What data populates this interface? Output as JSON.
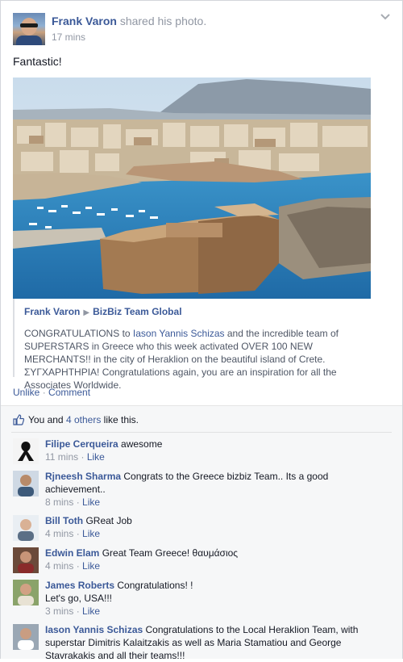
{
  "post": {
    "author": "Frank Varon",
    "action": "shared his photo.",
    "time": "17 mins",
    "status": "Fantastic!"
  },
  "attachment": {
    "source_author": "Frank Varon",
    "source_page": "BizBiz Team Global",
    "body_pre": "CONGRATULATIONS to ",
    "body_link": "Iason Yannis Schizas",
    "body_post": " and the incredible team of SUPERSTARS in Greece who this week activated OVER 100 NEW MERCHANTS!! in the city of Heraklion on the beautiful island of Crete. ΣΥΓΧΑΡΗΤΗΡΙΑ! Congratulations again, you are an inspiration for all the Associates Worldwide."
  },
  "actions": {
    "unlike": "Unlike",
    "sep": "·",
    "comment": "Comment"
  },
  "likes": {
    "prefix": "You and ",
    "others": "4 others",
    "suffix": " like this."
  },
  "comments": [
    {
      "author": "Filipe Cerqueira",
      "text": "awesome",
      "time": "11 mins",
      "like": "Like"
    },
    {
      "author": "Rjneesh Sharma",
      "text": "Congrats to the Greece bizbiz Team.. Its a good achievement..",
      "time": "8 mins",
      "like": "Like"
    },
    {
      "author": "Bill Toth",
      "text": "GReat Job",
      "time": "4 mins",
      "like": "Like"
    },
    {
      "author": "Edwin Elam",
      "text": "Great Team Greece! θαυμάσιος",
      "time": "4 mins",
      "like": "Like"
    },
    {
      "author": "James Roberts",
      "text": "Congratulations! !",
      "text2": "Let's go, USA!!!",
      "time": "3 mins",
      "like": "Like"
    },
    {
      "author": "Iason Yannis Schizas",
      "text": "Congratulations to the Local Heraklion Team, with superstar Dimitris Kalaitzakis as well as Maria Stamatiou and George Stavrakakis and all their teams!!!",
      "time": "",
      "like": ""
    }
  ],
  "colors": {
    "link": "#3b5998",
    "muted": "#9197a3",
    "ufi_bg": "#f6f7f8",
    "sea": "#2f7fb8"
  },
  "icons": {
    "chevron": "chevron-down-icon",
    "like": "thumbs-up-icon"
  }
}
